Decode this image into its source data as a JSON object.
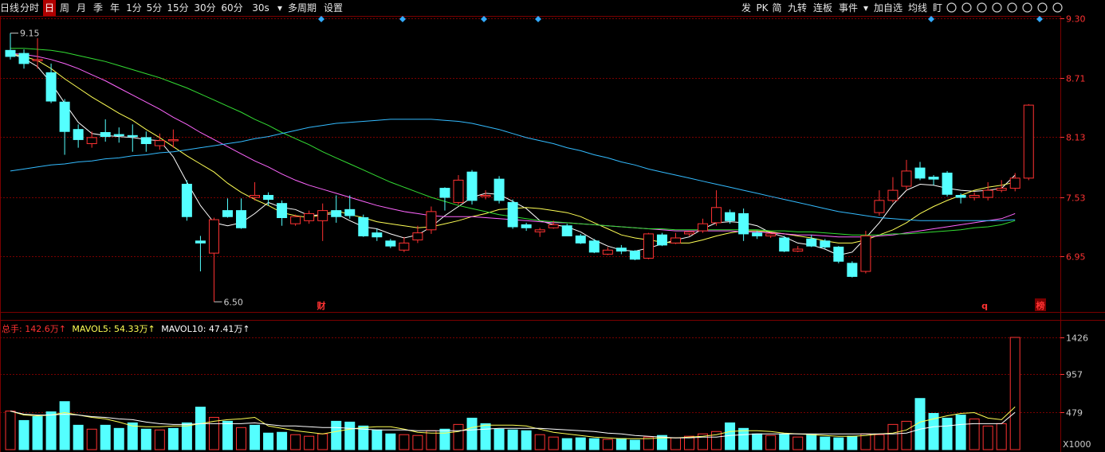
{
  "toolbar": {
    "left": [
      "日线",
      "分时",
      "日",
      "周",
      "月",
      "季",
      "年",
      "1分",
      "5分",
      "15分",
      "30分",
      "60分",
      "30s",
      "▾",
      "多周期",
      "设置"
    ],
    "active_index": 2,
    "right": [
      "发",
      "PK",
      "简",
      "九转",
      "连板",
      "事件",
      "▾",
      "加自选",
      "均线",
      "盯"
    ],
    "icons": [
      "settings-icon",
      "eye-icon",
      "print-icon",
      "lock-icon",
      "hand-icon",
      "pointer-icon",
      "zoom-in-icon",
      "zoom-out-icon"
    ]
  },
  "colors": {
    "bg": "#000000",
    "up": "#ff3232",
    "down": "#54ffff",
    "grid": "#7a0000",
    "axis_text": "#ff3232",
    "ma5": "#ffffff",
    "ma10": "#ffff55",
    "ma20": "#ff66ff",
    "ma30": "#33dd33",
    "ma60": "#33bbff",
    "diamond": "#33aaff"
  },
  "chart_data": [
    {
      "type": "candlestick",
      "y_ticks": [
        9.3,
        8.71,
        8.13,
        7.53,
        6.95
      ],
      "ylim": [
        6.4,
        9.32
      ],
      "high_label": "9.15",
      "low_label": "6.50",
      "markers": [
        "财",
        "q",
        "榜"
      ],
      "diamond_count": 6,
      "candles": [
        [
          8.98,
          8.92,
          9.15,
          8.89
        ],
        [
          8.95,
          8.85,
          8.99,
          8.8
        ],
        [
          8.88,
          8.89,
          9.1,
          8.8
        ],
        [
          8.76,
          8.48,
          8.85,
          8.46
        ],
        [
          8.47,
          8.18,
          8.5,
          7.95
        ],
        [
          8.2,
          8.1,
          8.25,
          8.02
        ],
        [
          8.06,
          8.12,
          8.18,
          8.02
        ],
        [
          8.17,
          8.13,
          8.3,
          8.08
        ],
        [
          8.15,
          8.14,
          8.22,
          8.07
        ],
        [
          8.14,
          8.13,
          8.25,
          7.98
        ],
        [
          8.12,
          8.06,
          8.18,
          7.98
        ],
        [
          8.04,
          8.09,
          8.16,
          8.0
        ],
        [
          8.1,
          8.1,
          8.2,
          8.02
        ],
        [
          7.66,
          7.34,
          7.7,
          7.3
        ],
        [
          7.1,
          7.08,
          7.15,
          6.8
        ],
        [
          6.98,
          7.31,
          7.33,
          6.5
        ],
        [
          7.4,
          7.34,
          7.52,
          7.33
        ],
        [
          7.4,
          7.23,
          7.52,
          7.22
        ],
        [
          7.53,
          7.55,
          7.68,
          7.5
        ],
        [
          7.55,
          7.51,
          7.58,
          7.45
        ],
        [
          7.47,
          7.33,
          7.5,
          7.25
        ],
        [
          7.27,
          7.34,
          7.36,
          7.25
        ],
        [
          7.3,
          7.37,
          7.4,
          7.27
        ],
        [
          7.3,
          7.4,
          7.47,
          7.1
        ],
        [
          7.4,
          7.34,
          7.55,
          7.28
        ],
        [
          7.41,
          7.35,
          7.55,
          7.32
        ],
        [
          7.33,
          7.15,
          7.36,
          7.14
        ],
        [
          7.18,
          7.14,
          7.22,
          7.1
        ],
        [
          7.1,
          7.05,
          7.12,
          7.03
        ],
        [
          7.01,
          7.08,
          7.14,
          6.99
        ],
        [
          7.11,
          7.18,
          7.25,
          7.08
        ],
        [
          7.21,
          7.39,
          7.44,
          7.17
        ],
        [
          7.62,
          7.53,
          7.63,
          7.4
        ],
        [
          7.48,
          7.7,
          7.75,
          7.46
        ],
        [
          7.78,
          7.5,
          7.8,
          7.46
        ],
        [
          7.55,
          7.55,
          7.6,
          7.51
        ],
        [
          7.71,
          7.5,
          7.74,
          7.47
        ],
        [
          7.48,
          7.24,
          7.51,
          7.22
        ],
        [
          7.26,
          7.23,
          7.28,
          7.2
        ],
        [
          7.19,
          7.21,
          7.23,
          7.14
        ],
        [
          7.23,
          7.26,
          7.3,
          7.22
        ],
        [
          7.25,
          7.15,
          7.27,
          7.15
        ],
        [
          7.15,
          7.08,
          7.17,
          7.07
        ],
        [
          7.1,
          6.99,
          7.12,
          6.98
        ],
        [
          6.97,
          7.01,
          7.04,
          6.96
        ],
        [
          7.03,
          7.0,
          7.06,
          6.97
        ],
        [
          7.0,
          6.92,
          7.01,
          6.91
        ],
        [
          6.93,
          7.17,
          7.18,
          6.92
        ],
        [
          7.16,
          7.06,
          7.18,
          7.05
        ],
        [
          7.08,
          7.13,
          7.18,
          7.07
        ],
        [
          7.17,
          7.19,
          7.2,
          7.15
        ],
        [
          7.2,
          7.27,
          7.32,
          7.18
        ],
        [
          7.28,
          7.43,
          7.6,
          7.25
        ],
        [
          7.38,
          7.3,
          7.41,
          7.27
        ],
        [
          7.37,
          7.17,
          7.42,
          7.1
        ],
        [
          7.18,
          7.15,
          7.2,
          7.12
        ],
        [
          7.15,
          7.17,
          7.18,
          7.13
        ],
        [
          7.13,
          7.0,
          7.15,
          6.99
        ],
        [
          7.0,
          7.02,
          7.05,
          6.99
        ],
        [
          7.12,
          7.05,
          7.16,
          7.04
        ],
        [
          7.1,
          7.04,
          7.12,
          7.02
        ],
        [
          7.04,
          6.9,
          7.05,
          6.88
        ],
        [
          6.88,
          6.75,
          6.9,
          6.74
        ],
        [
          6.8,
          7.15,
          7.2,
          6.78
        ],
        [
          7.38,
          7.5,
          7.6,
          7.35
        ],
        [
          7.5,
          7.6,
          7.73,
          7.48
        ],
        [
          7.64,
          7.79,
          7.9,
          7.6
        ],
        [
          7.82,
          7.72,
          7.88,
          7.7
        ],
        [
          7.73,
          7.71,
          7.75,
          7.65
        ],
        [
          7.77,
          7.56,
          7.79,
          7.54
        ],
        [
          7.55,
          7.53,
          7.57,
          7.47
        ],
        [
          7.53,
          7.55,
          7.58,
          7.5
        ],
        [
          7.53,
          7.6,
          7.68,
          7.5
        ],
        [
          7.6,
          7.62,
          7.7,
          7.58
        ],
        [
          7.62,
          7.72,
          7.77,
          7.59
        ],
        [
          7.72,
          8.44,
          8.45,
          7.7
        ]
      ],
      "ma": {
        "MA5": [
          8.95,
          8.9,
          8.82,
          8.66,
          8.46,
          8.27,
          8.16,
          8.14,
          8.13,
          8.12,
          8.1,
          8.09,
          7.93,
          7.68,
          7.45,
          7.28,
          7.25,
          7.28,
          7.37,
          7.48,
          7.43,
          7.41,
          7.35,
          7.36,
          7.37,
          7.3,
          7.24,
          7.22,
          7.17,
          7.13,
          7.16,
          7.24,
          7.35,
          7.44,
          7.53,
          7.57,
          7.56,
          7.49,
          7.42,
          7.3,
          7.26,
          7.24,
          7.19,
          7.11,
          7.05,
          7.01,
          7.0,
          7.03,
          7.07,
          7.11,
          7.14,
          7.22,
          7.28,
          7.29,
          7.28,
          7.25,
          7.18,
          7.14,
          7.08,
          7.06,
          7.02,
          6.96,
          6.99,
          7.13,
          7.28,
          7.46,
          7.6,
          7.66,
          7.65,
          7.62,
          7.6,
          7.59,
          7.6,
          7.62,
          7.75
        ],
        "MA10": [
          8.95,
          8.92,
          8.88,
          8.8,
          8.7,
          8.61,
          8.52,
          8.44,
          8.36,
          8.29,
          8.2,
          8.12,
          8.03,
          7.94,
          7.86,
          7.78,
          7.67,
          7.58,
          7.51,
          7.45,
          7.38,
          7.35,
          7.33,
          7.36,
          7.4,
          7.36,
          7.33,
          7.29,
          7.27,
          7.25,
          7.23,
          7.24,
          7.27,
          7.3,
          7.34,
          7.37,
          7.41,
          7.42,
          7.43,
          7.42,
          7.4,
          7.38,
          7.34,
          7.28,
          7.22,
          7.16,
          7.13,
          7.11,
          7.09,
          7.08,
          7.08,
          7.11,
          7.15,
          7.18,
          7.2,
          7.2,
          7.19,
          7.17,
          7.15,
          7.13,
          7.1,
          7.08,
          7.08,
          7.11,
          7.16,
          7.21,
          7.28,
          7.37,
          7.44,
          7.5,
          7.55,
          7.6,
          7.63,
          7.65,
          7.68
        ],
        "MA20": [
          8.95,
          8.94,
          8.92,
          8.89,
          8.85,
          8.8,
          8.74,
          8.68,
          8.61,
          8.54,
          8.47,
          8.4,
          8.32,
          8.25,
          8.17,
          8.1,
          8.03,
          7.96,
          7.89,
          7.83,
          7.76,
          7.7,
          7.65,
          7.61,
          7.57,
          7.53,
          7.49,
          7.45,
          7.42,
          7.39,
          7.37,
          7.35,
          7.34,
          7.34,
          7.34,
          7.33,
          7.32,
          7.31,
          7.3,
          7.29,
          7.28,
          7.28,
          7.27,
          7.26,
          7.25,
          7.24,
          7.23,
          7.22,
          7.21,
          7.2,
          7.2,
          7.2,
          7.2,
          7.2,
          7.19,
          7.19,
          7.18,
          7.17,
          7.16,
          7.16,
          7.15,
          7.14,
          7.14,
          7.14,
          7.15,
          7.16,
          7.18,
          7.2,
          7.22,
          7.24,
          7.26,
          7.28,
          7.3,
          7.32,
          7.37
        ],
        "MA30": [
          9.0,
          9.0,
          8.99,
          8.98,
          8.96,
          8.93,
          8.9,
          8.87,
          8.83,
          8.79,
          8.75,
          8.71,
          8.66,
          8.61,
          8.55,
          8.49,
          8.43,
          8.37,
          8.3,
          8.24,
          8.17,
          8.11,
          8.05,
          7.98,
          7.92,
          7.86,
          7.8,
          7.74,
          7.68,
          7.63,
          7.58,
          7.53,
          7.49,
          7.45,
          7.42,
          7.39,
          7.36,
          7.34,
          7.32,
          7.3,
          7.29,
          7.28,
          7.27,
          7.26,
          7.25,
          7.24,
          7.23,
          7.22,
          7.22,
          7.21,
          7.21,
          7.21,
          7.21,
          7.21,
          7.21,
          7.21,
          7.2,
          7.2,
          7.19,
          7.19,
          7.18,
          7.17,
          7.16,
          7.16,
          7.16,
          7.17,
          7.17,
          7.18,
          7.19,
          7.2,
          7.21,
          7.23,
          7.24,
          7.26,
          7.3
        ],
        "MA60": [
          7.79,
          7.81,
          7.83,
          7.85,
          7.86,
          7.88,
          7.89,
          7.91,
          7.92,
          7.94,
          7.95,
          7.97,
          7.98,
          8.0,
          8.02,
          8.04,
          8.06,
          8.08,
          8.11,
          8.13,
          8.16,
          8.19,
          8.22,
          8.24,
          8.26,
          8.27,
          8.28,
          8.29,
          8.3,
          8.3,
          8.3,
          8.3,
          8.29,
          8.28,
          8.26,
          8.23,
          8.2,
          8.16,
          8.12,
          8.09,
          8.06,
          8.02,
          7.99,
          7.95,
          7.92,
          7.88,
          7.85,
          7.81,
          7.78,
          7.75,
          7.72,
          7.69,
          7.66,
          7.63,
          7.6,
          7.57,
          7.54,
          7.51,
          7.48,
          7.45,
          7.42,
          7.39,
          7.37,
          7.35,
          7.33,
          7.32,
          7.31,
          7.3,
          7.3,
          7.3,
          7.3,
          7.3,
          7.3,
          7.3,
          7.31
        ]
      }
    },
    {
      "type": "bar",
      "unit_label": "X1000",
      "y_ticks": [
        1426,
        957,
        479
      ],
      "ylim": [
        0,
        1426
      ],
      "legend": {
        "total": "总手: 142.6万↑",
        "mavol5": "MAVOL5: 54.33万↑",
        "mavol10": "MAVOL10: 47.41万↑"
      },
      "values": [
        490,
        370,
        420,
        480,
        610,
        310,
        260,
        310,
        270,
        340,
        260,
        250,
        270,
        340,
        540,
        410,
        360,
        280,
        310,
        210,
        220,
        190,
        170,
        200,
        360,
        350,
        300,
        250,
        200,
        190,
        180,
        240,
        260,
        320,
        400,
        330,
        260,
        250,
        240,
        190,
        160,
        140,
        150,
        140,
        130,
        140,
        120,
        160,
        180,
        150,
        170,
        200,
        230,
        340,
        270,
        200,
        180,
        200,
        160,
        190,
        160,
        150,
        170,
        200,
        190,
        320,
        360,
        650,
        460,
        400,
        440,
        390,
        300,
        330,
        1426
      ],
      "up": [
        true,
        false,
        false,
        false,
        false,
        false,
        true,
        false,
        false,
        false,
        false,
        true,
        false,
        false,
        false,
        true,
        false,
        true,
        false,
        false,
        false,
        true,
        true,
        true,
        false,
        false,
        false,
        false,
        false,
        true,
        true,
        true,
        false,
        true,
        false,
        false,
        false,
        false,
        false,
        true,
        true,
        false,
        false,
        false,
        true,
        false,
        false,
        true,
        false,
        true,
        true,
        true,
        true,
        false,
        false,
        false,
        true,
        false,
        true,
        false,
        false,
        false,
        false,
        true,
        true,
        true,
        true,
        false,
        false,
        false,
        false,
        true,
        true,
        true,
        true
      ],
      "mavol5": [
        490,
        440,
        430,
        440,
        470,
        440,
        410,
        390,
        350,
        300,
        290,
        290,
        300,
        300,
        330,
        360,
        380,
        390,
        410,
        300,
        270,
        240,
        220,
        200,
        230,
        260,
        280,
        290,
        290,
        260,
        220,
        210,
        210,
        230,
        280,
        310,
        310,
        310,
        300,
        260,
        220,
        200,
        180,
        160,
        150,
        140,
        140,
        140,
        150,
        150,
        160,
        170,
        190,
        230,
        240,
        240,
        230,
        210,
        200,
        190,
        180,
        170,
        170,
        180,
        200,
        210,
        250,
        350,
        390,
        430,
        460,
        470,
        400,
        380,
        543
      ],
      "mavol10": [
        490,
        450,
        440,
        440,
        450,
        440,
        420,
        410,
        390,
        380,
        350,
        330,
        320,
        320,
        330,
        330,
        330,
        330,
        340,
        320,
        300,
        300,
        290,
        280,
        280,
        270,
        260,
        250,
        250,
        250,
        240,
        240,
        240,
        240,
        250,
        260,
        270,
        270,
        270,
        270,
        260,
        250,
        240,
        230,
        210,
        200,
        180,
        170,
        160,
        150,
        150,
        160,
        160,
        180,
        190,
        200,
        200,
        200,
        200,
        200,
        200,
        200,
        200,
        200,
        200,
        200,
        210,
        260,
        290,
        300,
        320,
        330,
        330,
        330,
        474
      ]
    }
  ]
}
